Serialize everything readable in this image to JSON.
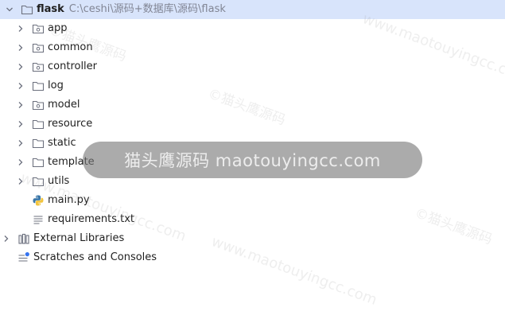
{
  "project": {
    "name": "flask",
    "path": "C:\\ceshi\\源码+数据库\\源码\\flask"
  },
  "items": [
    {
      "label": "app"
    },
    {
      "label": "common"
    },
    {
      "label": "controller"
    },
    {
      "label": "log"
    },
    {
      "label": "model"
    },
    {
      "label": "resource"
    },
    {
      "label": "static"
    },
    {
      "label": "template"
    },
    {
      "label": "utils"
    },
    {
      "label": "main.py"
    },
    {
      "label": "requirements.txt"
    }
  ],
  "external_libraries": {
    "label": "External Libraries"
  },
  "scratches": {
    "label": "Scratches and Consoles"
  },
  "overlay": {
    "text": "猫头鹰源码 maotouyingcc.com"
  },
  "watermark": {
    "cn": "©猫头鹰源码",
    "en": "www.maotouyingcc.com"
  },
  "colors": {
    "selection": "#d8e4fb",
    "path_text": "#818594",
    "python_blue": "#3b77a8",
    "python_yellow": "#f2c43d",
    "scratch_badge": "#3574f0"
  }
}
